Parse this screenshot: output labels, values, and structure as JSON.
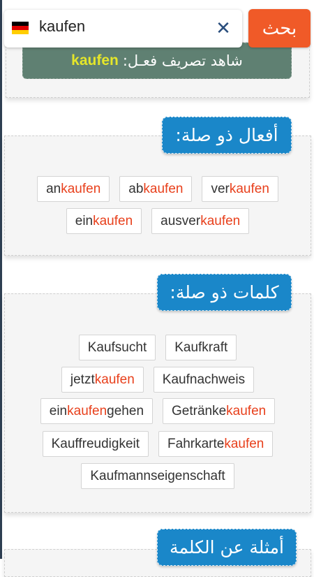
{
  "search": {
    "value": "kaufen",
    "button_label": "بحث",
    "clear_icon": "close-icon",
    "flag_icon": "german-flag-icon",
    "flag_colors": [
      "#000000",
      "#dd0000",
      "#ffce00"
    ]
  },
  "conjugation": {
    "label": "شاهد تصريف فعـل:",
    "verb": "kaufen"
  },
  "related_verbs": {
    "title": "أفعال ذو صلة:",
    "rows": [
      [
        {
          "pre": "an",
          "hl": "kaufen",
          "post": ""
        },
        {
          "pre": "ab",
          "hl": "kaufen",
          "post": ""
        },
        {
          "pre": "ver",
          "hl": "kaufen",
          "post": ""
        }
      ],
      [
        {
          "pre": "ein",
          "hl": "kaufen",
          "post": ""
        },
        {
          "pre": "ausver",
          "hl": "kaufen",
          "post": ""
        }
      ]
    ]
  },
  "related_words": {
    "title": "كلمات ذو صلة:",
    "rows": [
      [
        {
          "pre": "Kaufsucht",
          "hl": "",
          "post": ""
        },
        {
          "pre": "Kaufkraft",
          "hl": "",
          "post": ""
        }
      ],
      [
        {
          "pre": "jetzt ",
          "hl": "kaufen",
          "post": ""
        },
        {
          "pre": "Kaufnachweis",
          "hl": "",
          "post": ""
        }
      ],
      [
        {
          "pre": "ein",
          "hl": "kaufen",
          "post": " gehen"
        },
        {
          "pre": "Getränke ",
          "hl": "kaufen",
          "post": ""
        }
      ],
      [
        {
          "pre": "Kauffreudigkeit",
          "hl": "",
          "post": ""
        },
        {
          "pre": "Fahrkarte ",
          "hl": "kaufen",
          "post": ""
        }
      ],
      [
        {
          "pre": "Kaufmannseigenschaft",
          "hl": "",
          "post": ""
        }
      ]
    ]
  },
  "examples": {
    "title": "أمثلة عن الكلمة"
  },
  "colors": {
    "accent_orange": "#f05a28",
    "section_blue": "#1a87c9",
    "conj_green": "#5f8072",
    "verb_yellow": "#e5e62a",
    "highlight_red": "#e8401c"
  }
}
